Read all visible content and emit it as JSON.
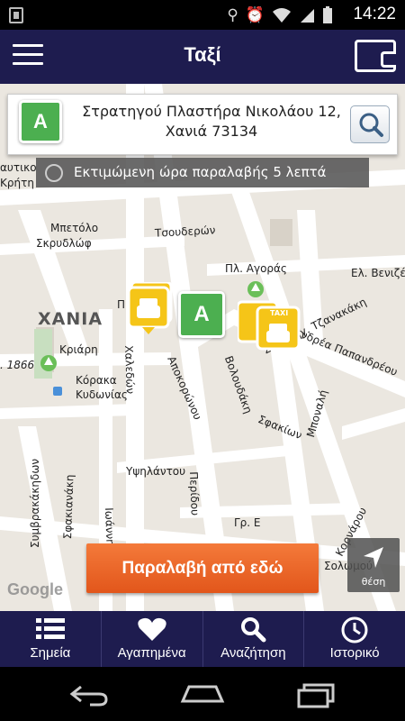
{
  "status_bar": {
    "time": "14:22"
  },
  "header": {
    "title": "Ταξί"
  },
  "address": {
    "line1": "Στρατηγού Πλαστήρα Νικολάου 12,",
    "line2": "Χανιά 73134",
    "marker_letter": "A"
  },
  "pickup_notice": "Εκτιμώμενη ώρα παραλαβής 5 λεπτά",
  "map": {
    "district": "ΧΑΝΙΑ",
    "streets": {
      "s1": "αυτικο",
      "s2": "Κρήτη",
      "s3": "Μπετόλο",
      "s4": "Σκρυδλώφ",
      "s5": "Τσουδερών",
      "s6": "Πλ. Αγοράς",
      "s7": "Ελ. Βενιζέ",
      "s8": "Ανδρέα Παπανδρέου",
      "s9": "Κριάρη",
      "s10": "Κόρακα",
      "s11": "Κυδωνίας",
      "s12": "Χαλεδών",
      "s13": "Αποκορώνου",
      "s14": "Βολουδάκη",
      "s15": "Στρατηγ. Τζανακάκη",
      "s16": "Σφακίων",
      "s17": "Μποναλή",
      "s18": "Υψηλάντου",
      "s19": "Περίδου",
      "s20": "Συμβρακάκηδων",
      "s21": "Σφακιανάκη",
      "s22": "Ιωάννη",
      "s23": "Γρ. Ε",
      "s24": "Κορνάρου",
      "s25": "Σολωμού",
      "s26": ". 1866",
      "s27": "Π"
    },
    "taxi_label": "TAXI",
    "destination_marker": "A"
  },
  "pickup_button": "Παραλαβή από εδώ",
  "location_button": "θέση",
  "google": "Google",
  "tabs": [
    {
      "label": "Σημεία",
      "icon": "list-icon"
    },
    {
      "label": "Αγαπημένα",
      "icon": "heart-icon"
    },
    {
      "label": "Αναζήτηση",
      "icon": "search-icon"
    },
    {
      "label": "Ιστορικό",
      "icon": "history-icon"
    }
  ],
  "colors": {
    "header": "#1e1c4f",
    "pickup": "#e8612a",
    "marker_green": "#4caf50",
    "taxi_yellow": "#f5c518"
  }
}
